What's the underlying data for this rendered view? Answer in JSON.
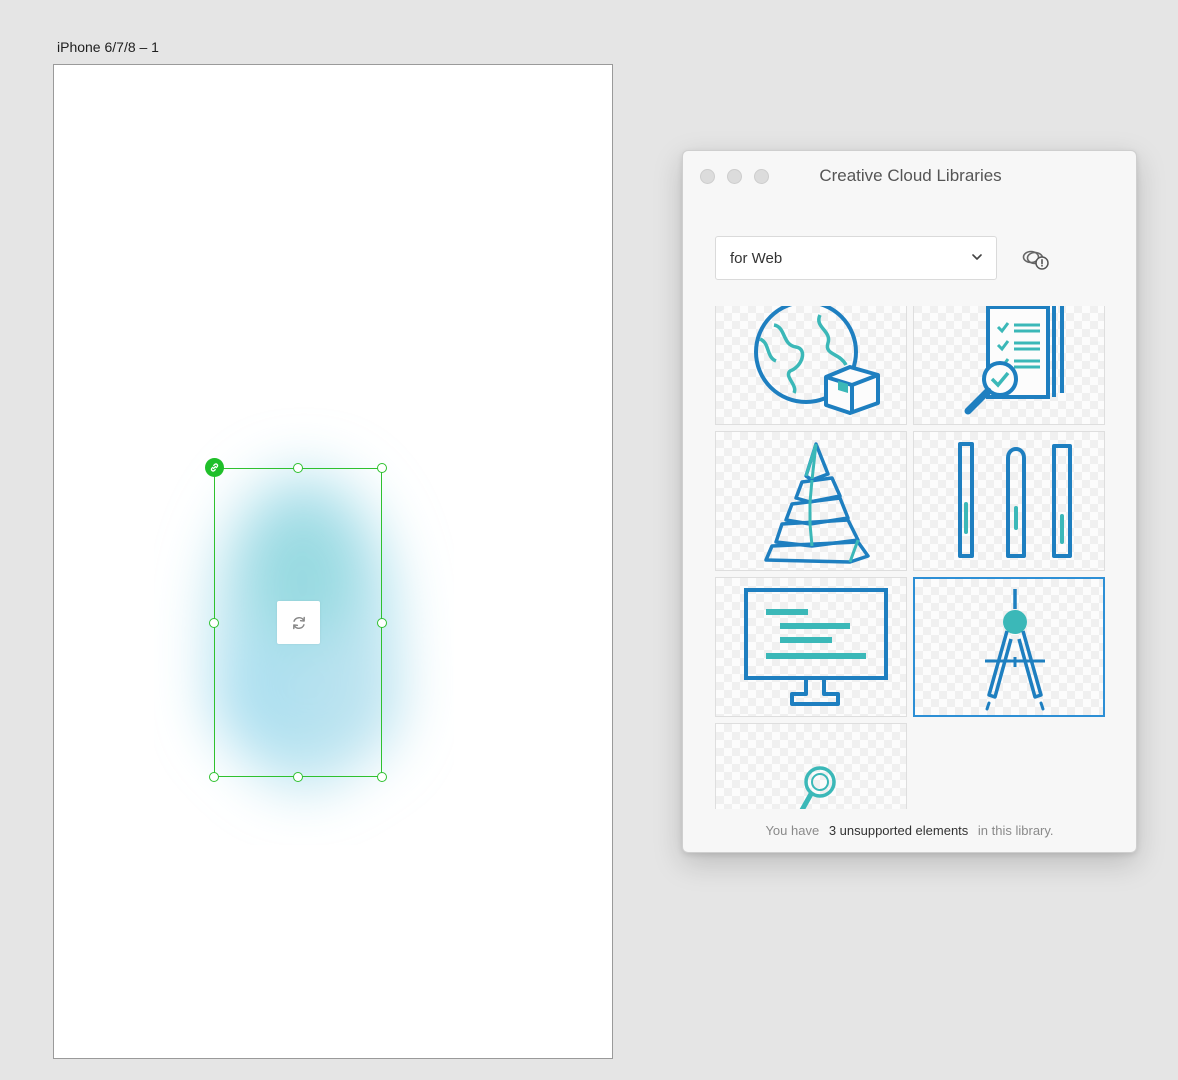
{
  "artboard": {
    "label": "iPhone 6/7/8 – 1"
  },
  "panel": {
    "title": "Creative Cloud Libraries",
    "library_select": {
      "value": "for Web"
    },
    "footer": {
      "prefix": "You have",
      "highlight": "3 unsupported elements",
      "suffix": "in this library."
    },
    "assets": [
      {
        "icon": "globe-package-icon"
      },
      {
        "icon": "checklist-magnifier-icon"
      },
      {
        "icon": "pyramid-icon"
      },
      {
        "icon": "test-tubes-icon"
      },
      {
        "icon": "monitor-gantt-icon"
      },
      {
        "icon": "compass-tool-icon",
        "selected": true
      },
      {
        "icon": "magnifier-icon"
      }
    ]
  },
  "colors": {
    "selection": "#2fc12f",
    "icon_blue": "#1e7fc0",
    "icon_teal": "#3bb8b8",
    "selected_tile_border": "#2d8fd5"
  }
}
